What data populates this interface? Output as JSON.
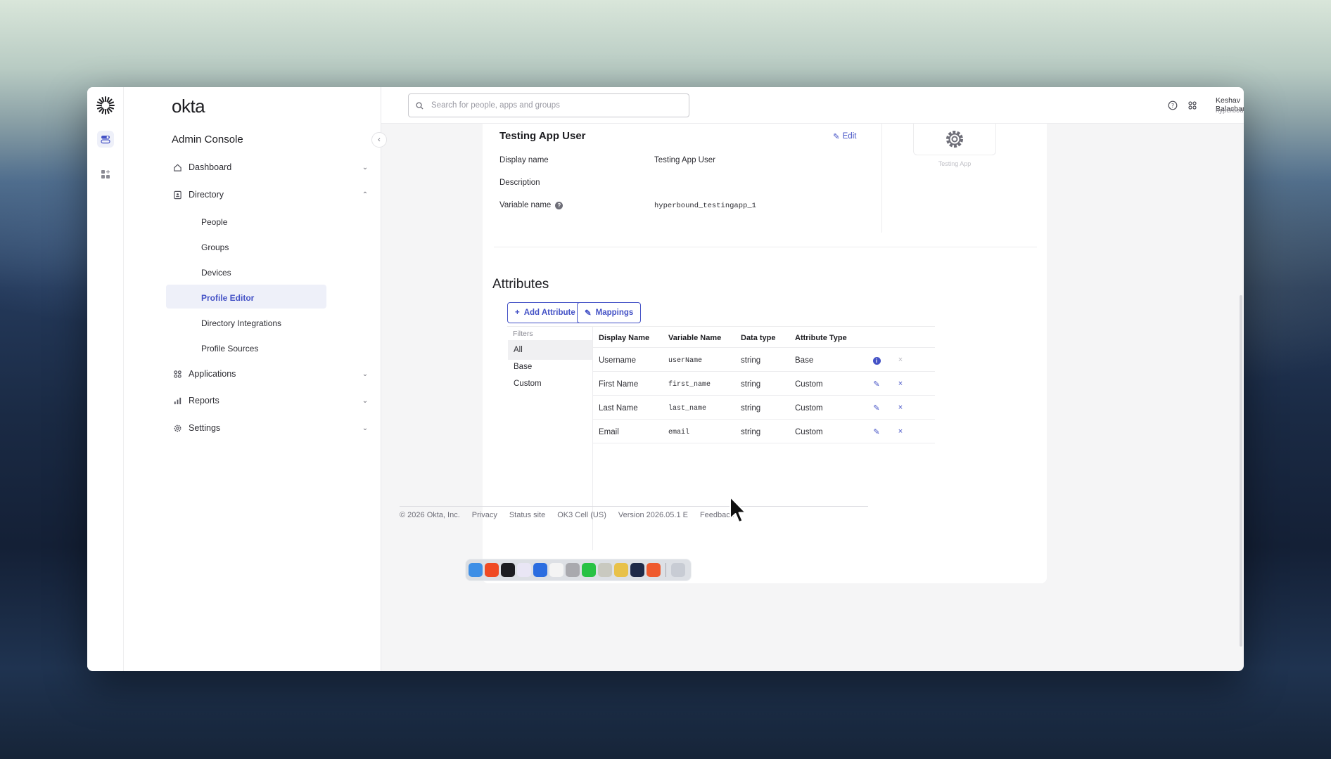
{
  "brand": {
    "logo_text": "okta",
    "console_title": "Admin Console"
  },
  "search": {
    "placeholder": "Search for people, apps and groups"
  },
  "user": {
    "name": "Keshav Balachandar",
    "org": "hyperbound"
  },
  "nav": {
    "dashboard": "Dashboard",
    "directory": "Directory",
    "directory_items": [
      "People",
      "Groups",
      "Devices",
      "Profile Editor",
      "Directory Integrations",
      "Profile Sources"
    ],
    "applications": "Applications",
    "reports": "Reports",
    "settings": "Settings",
    "active_item": "Profile Editor"
  },
  "profile": {
    "title": "Testing App User",
    "edit_label": "Edit",
    "fields": [
      {
        "label": "Display name",
        "value": "Testing App User"
      },
      {
        "label": "Description",
        "value": ""
      },
      {
        "label": "Variable name",
        "value": "hyperbound_testingapp_1"
      }
    ],
    "app_label": "Testing App"
  },
  "attributes": {
    "title": "Attributes",
    "add_button": "Add Attribute",
    "mappings_button": "Mappings",
    "filters_label": "Filters",
    "filters": [
      "All",
      "Base",
      "Custom"
    ],
    "active_filter": "All",
    "columns": [
      "Display Name",
      "Variable Name",
      "Data type",
      "Attribute Type"
    ],
    "rows": [
      {
        "display": "Username",
        "variable": "userName",
        "type": "string",
        "attr_type": "Base"
      },
      {
        "display": "First Name",
        "variable": "first_name",
        "type": "string",
        "attr_type": "Custom"
      },
      {
        "display": "Last Name",
        "variable": "last_name",
        "type": "string",
        "attr_type": "Custom"
      },
      {
        "display": "Email",
        "variable": "email",
        "type": "string",
        "attr_type": "Custom"
      }
    ]
  },
  "footer": {
    "copyright": "© 2026 Okta, Inc.",
    "links": [
      "Privacy",
      "Status site",
      "OK3 Cell (US)",
      "Version 2026.05.1 E",
      "Feedback"
    ]
  },
  "colors": {
    "accent": "#4452c6",
    "active_bg": "#eef0f9"
  },
  "icons": {
    "rail": [
      "okta-burst-icon",
      "toggle-icon",
      "grid-add-icon"
    ],
    "top": [
      "help-icon",
      "apps-grid-icon",
      "chevron-down-icon"
    ]
  }
}
